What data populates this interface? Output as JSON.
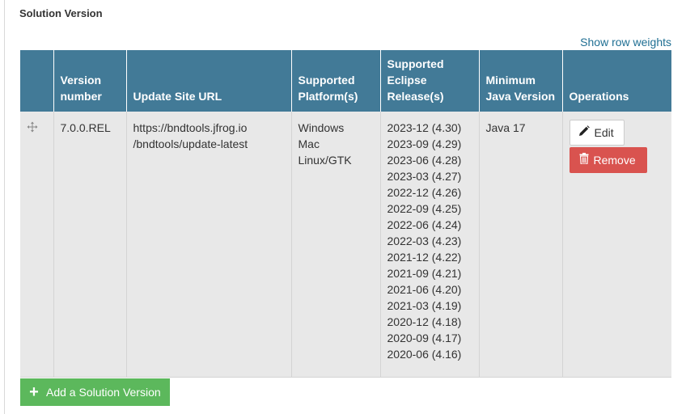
{
  "section": {
    "title": "Solution Version",
    "row_weights_link": "Show row weights"
  },
  "table": {
    "headers": {
      "drag": "",
      "version": "Version number",
      "url": "Update Site URL",
      "platforms": "Supported Platform(s)",
      "eclipse": "Supported Eclipse Release(s)",
      "java": "Minimum Java Version",
      "operations": "Operations"
    },
    "rows": [
      {
        "version": "7.0.0.REL",
        "url_line1": "https://bndtools.jfrog.io",
        "url_line2": "/bndtools/update-latest",
        "platforms": [
          "Windows",
          "Mac",
          "Linux/GTK"
        ],
        "eclipse": [
          "2023-12 (4.30)",
          "2023-09 (4.29)",
          "2023-06 (4.28)",
          "2023-03 (4.27)",
          "2022-12 (4.26)",
          "2022-09 (4.25)",
          "2022-06 (4.24)",
          "2022-03 (4.23)",
          "2021-12 (4.22)",
          "2021-09 (4.21)",
          "2021-06 (4.20)",
          "2021-03 (4.19)",
          "2020-12 (4.18)",
          "2020-09 (4.17)",
          "2020-06 (4.16)"
        ],
        "java": "Java 17",
        "edit_label": "Edit",
        "remove_label": "Remove"
      }
    ]
  },
  "add_button": {
    "label": "Add a Solution Version",
    "icon": "plus-icon"
  },
  "colors": {
    "header_bg": "#427a97",
    "link": "#1f6f93",
    "remove": "#d9534f",
    "add": "#5cb85c",
    "row_bg": "#e8e8e8"
  }
}
